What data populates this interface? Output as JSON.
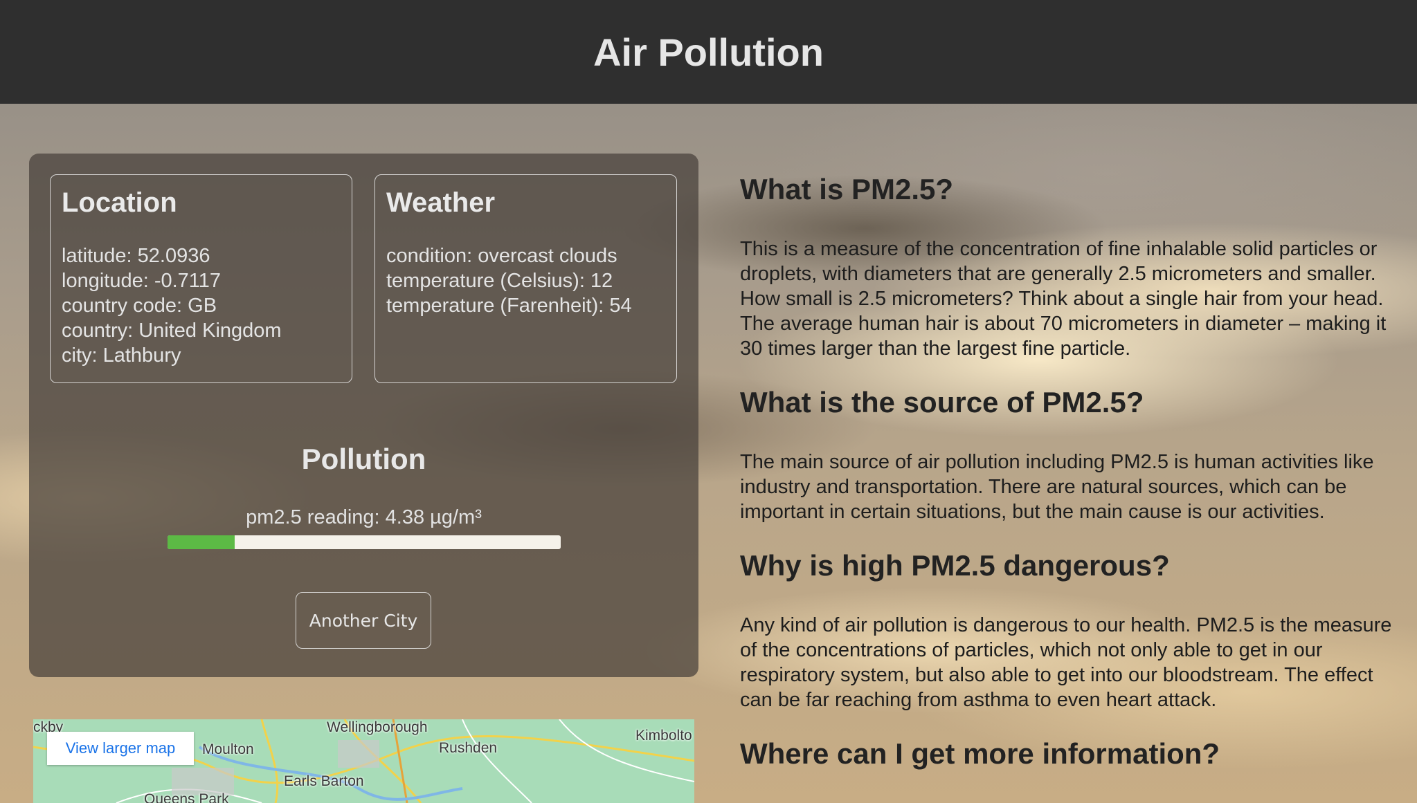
{
  "header": {
    "title": "Air Pollution"
  },
  "location": {
    "heading": "Location",
    "lines": [
      "latitude: 52.0936",
      "longitude: -0.7117",
      "country code: GB",
      "country: United Kingdom",
      "city: Lathbury"
    ]
  },
  "weather": {
    "heading": "Weather",
    "lines": [
      "condition: overcast clouds",
      "temperature (Celsius): 12",
      "temperature (Farenheit): 54"
    ]
  },
  "pollution": {
    "heading": "Pollution",
    "reading": "pm2.5 reading: 4.38 µg/m³",
    "level_fraction": 0.17,
    "bar_color": "#5cba45",
    "button_label": "Another City"
  },
  "map": {
    "link_label": "View larger map",
    "places": [
      "ckby",
      "Wellingborough",
      "Kimbolto",
      "Moulton",
      "Rushden",
      "Earls Barton",
      "Queens Park"
    ]
  },
  "article": {
    "sections": [
      {
        "heading": "What is PM2.5?",
        "body": "This is a measure of the concentration of fine inhalable solid particles or droplets, with diameters that are generally 2.5 micrometers and smaller. How small is 2.5 micrometers? Think about a single hair from your head. The average human hair is about 70 micrometers in diameter – making it 30 times larger than the largest fine particle."
      },
      {
        "heading": "What is the source of PM2.5?",
        "body": "The main source of air pollution including PM2.5 is human activities like industry and transportation. There are natural sources, which can be important in certain situations, but the main cause is our activities."
      },
      {
        "heading": "Why is high PM2.5 dangerous?",
        "body": "Any kind of air pollution is dangerous to our health. PM2.5 is the measure of the concentrations of particles, which not only able to get in our respiratory system, but also able to get into our bloodstream. The effect can be far reaching from asthma to even heart attack."
      },
      {
        "heading": "Where can I get more information?",
        "body": ""
      }
    ]
  }
}
